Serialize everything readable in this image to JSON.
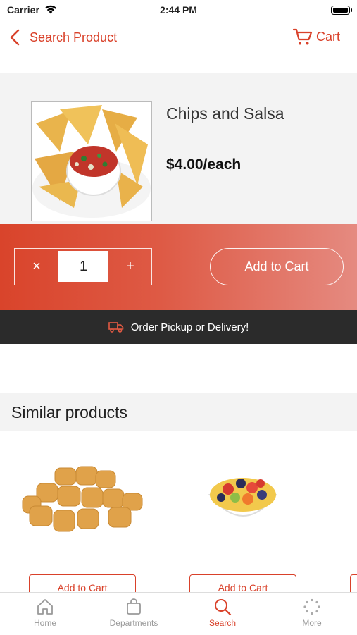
{
  "status_bar": {
    "carrier": "Carrier",
    "time": "2:44 PM"
  },
  "nav": {
    "back_label": "Search Product",
    "cart_label": "Cart"
  },
  "product": {
    "name": "Chips and Salsa",
    "price": "$4.00/each",
    "image_icon": "chips-and-salsa-image"
  },
  "cart_controls": {
    "decrement": "×",
    "quantity": "1",
    "increment": "+",
    "add_label": "Add to Cart"
  },
  "banner": {
    "text": "Order Pickup or Delivery!"
  },
  "similar": {
    "title": "Similar products",
    "items": [
      {
        "image": "tater-tots-image",
        "button": "Add to Cart"
      },
      {
        "image": "fruit-bowl-image",
        "button": "Add to Cart"
      }
    ]
  },
  "tabs": [
    {
      "label": "Home",
      "icon": "home-icon"
    },
    {
      "label": "Departments",
      "icon": "bag-icon"
    },
    {
      "label": "Search",
      "icon": "search-icon",
      "active": true
    },
    {
      "label": "More",
      "icon": "more-icon"
    }
  ],
  "colors": {
    "accent": "#d9412a",
    "dark_bar": "#2b2b2b",
    "panel": "#f3f3f3"
  }
}
